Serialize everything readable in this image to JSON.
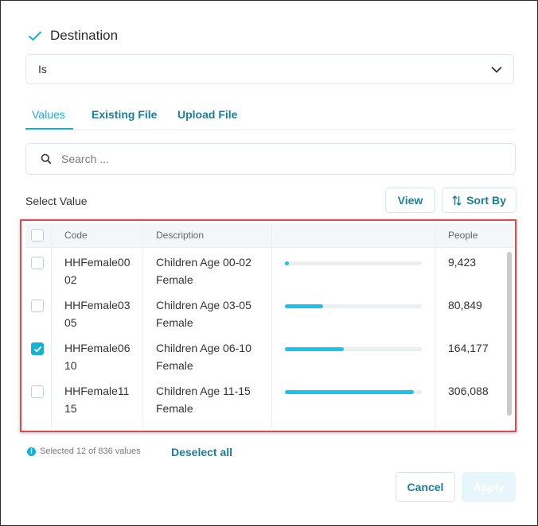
{
  "filter": {
    "title": "Destination",
    "operator": "Is"
  },
  "tabs": [
    {
      "label": "Values",
      "active": true
    },
    {
      "label": "Existing File",
      "active": false
    },
    {
      "label": "Upload File",
      "active": false
    }
  ],
  "search": {
    "placeholder": "Search ..."
  },
  "select_value_label": "Select Value",
  "toolbar": {
    "view_label": "View",
    "sort_label": "Sort By"
  },
  "table": {
    "columns": {
      "code": "Code",
      "description": "Description",
      "people": "People"
    },
    "rows": [
      {
        "code_line1": "HHFemale00",
        "code_line2": "02",
        "desc_line1": "Children Age 00-02",
        "desc_line2": "Female",
        "people": "9,423",
        "share": 0.03,
        "checked": false
      },
      {
        "code_line1": "HHFemale03",
        "code_line2": "05",
        "desc_line1": "Children Age 03-05",
        "desc_line2": "Female",
        "people": "80,849",
        "share": 0.28,
        "checked": false
      },
      {
        "code_line1": "HHFemale06",
        "code_line2": "10",
        "desc_line1": "Children Age 06-10",
        "desc_line2": "Female",
        "people": "164,177",
        "share": 0.43,
        "checked": true
      },
      {
        "code_line1": "HHFemale11",
        "code_line2": "15",
        "desc_line1": "Children Age 11-15",
        "desc_line2": "Female",
        "people": "306,088",
        "share": 0.94,
        "checked": false
      }
    ]
  },
  "footer": {
    "selected_text": "Selected 12 of 836 values",
    "deselect_all": "Deselect all",
    "cancel": "Cancel",
    "apply": "Apply"
  },
  "colors": {
    "accent": "#19b0d6",
    "link": "#1d7d95",
    "highlight": "#e0494e",
    "bar": "#19c3ea"
  }
}
